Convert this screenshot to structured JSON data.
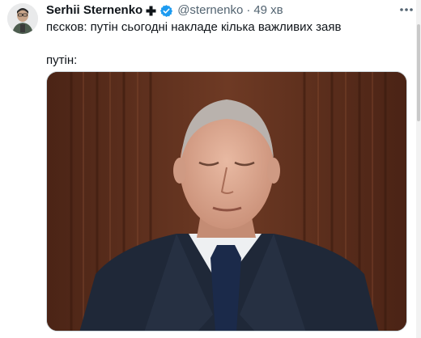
{
  "tweet": {
    "author": {
      "name": "Serhii Sternenko",
      "handle": "@sternenko",
      "avatar_icon": "avatar-photo-icon"
    },
    "separator": "·",
    "time": "49 хв",
    "badge_icon": "cross-badge-icon",
    "verified_icon": "verified-badge-icon",
    "more_icon": "more-options-icon",
    "verified_color": "#1d9bf0",
    "text_lines": [
      "пєсков: путін сьогодні накладе кілька важливих заяв",
      "путін:"
    ]
  }
}
